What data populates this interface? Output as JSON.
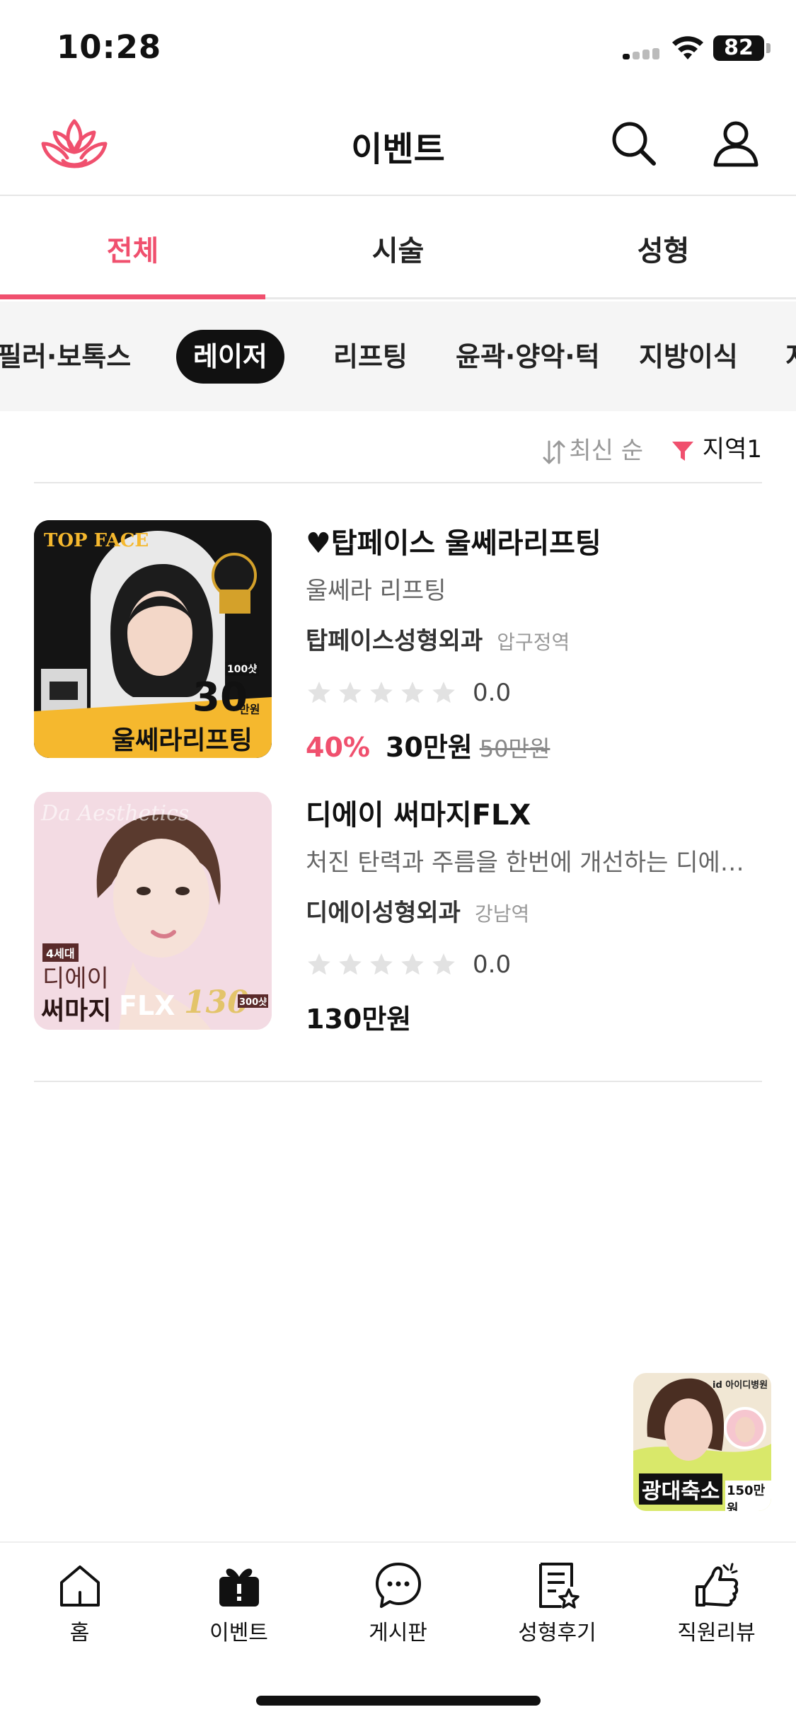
{
  "status_bar": {
    "time": "10:28",
    "battery": "82"
  },
  "header": {
    "title": "이벤트",
    "logo_icon": "lotus-logo-icon",
    "search_icon": "search-icon",
    "user_icon": "user-icon"
  },
  "main_tabs": [
    {
      "label": "전체",
      "active": true
    },
    {
      "label": "시술",
      "active": false
    },
    {
      "label": "성형",
      "active": false
    }
  ],
  "sub_tabs": [
    {
      "label": "필러·보톡스",
      "active": false
    },
    {
      "label": "레이저",
      "active": true
    },
    {
      "label": "리프팅",
      "active": false
    },
    {
      "label": "윤곽·양악·턱",
      "active": false
    },
    {
      "label": "지방이식",
      "active": false
    },
    {
      "label": "지",
      "active": false
    }
  ],
  "filters": {
    "sort_label": "최신 순",
    "region_label": "지역1"
  },
  "events": [
    {
      "title": "♥탑페이스 울쎄라리프팅",
      "description": "울쎄라 리프팅",
      "clinic": "탑페이스성형외과",
      "station": "압구정역",
      "rating": "0.0",
      "discount": "40%",
      "price": "30만원",
      "original_price": "50만원",
      "thumb": {
        "brand": "TOP FACE",
        "big_number": "30",
        "unit": "만원",
        "shots": "100샷",
        "caption": "울쎄라리프팅"
      }
    },
    {
      "title": "디에이 써마지FLX",
      "description": "처진 탄력과 주름을 한번에 개선하는 디에이...",
      "clinic": "디에이성형외과",
      "station": "강남역",
      "rating": "0.0",
      "discount": "",
      "price": "130만원",
      "original_price": "",
      "thumb": {
        "badge": "4세대",
        "line1": "디에이",
        "line2": "써마지",
        "model": "FLX",
        "big_number": "130",
        "shots": "300샷"
      }
    }
  ],
  "floating_banner": {
    "brand": "id 아이디병원",
    "caption": "광대축소",
    "price": "150만원"
  },
  "bottom_nav": [
    {
      "label": "홈",
      "icon": "home-icon"
    },
    {
      "label": "이벤트",
      "icon": "gift-icon"
    },
    {
      "label": "게시판",
      "icon": "chat-bubble-icon"
    },
    {
      "label": "성형후기",
      "icon": "review-document-icon"
    },
    {
      "label": "직원리뷰",
      "icon": "thumbs-up-icon"
    }
  ],
  "colors": {
    "accent": "#f0506e",
    "chip_active": "#111111",
    "sub_tab_bg": "#f5f5f5"
  }
}
